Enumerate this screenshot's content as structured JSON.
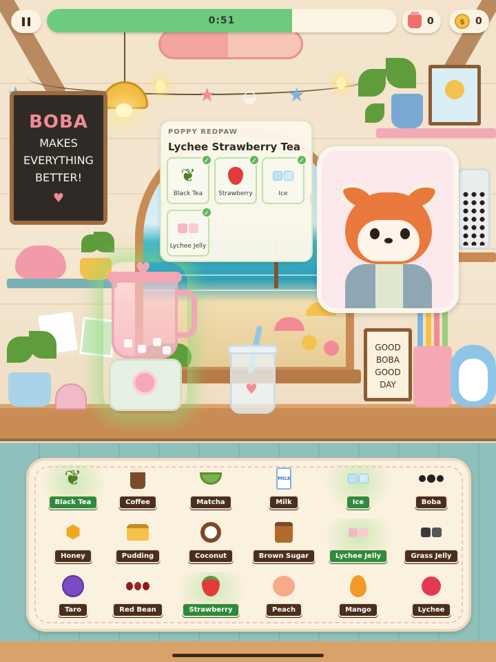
{
  "hud": {
    "timer_text": "0:51",
    "timer_fraction": 0.7,
    "cups_count": "0",
    "coins_count": "0",
    "coin_symbol": "$"
  },
  "decor": {
    "chalkboard": [
      "BOBA",
      "MAKES",
      "EVERYTHING",
      "BETTER!"
    ],
    "sign": [
      "GOOD",
      "BOBA",
      "GOOD DAY"
    ]
  },
  "order": {
    "customer_name": "POPPY REDPAW",
    "drink_name": "Lychee Strawberry Tea",
    "ingredients": [
      {
        "label": "Black Tea",
        "icon": "tea-leaf-icon",
        "done": true
      },
      {
        "label": "Strawberry",
        "icon": "strawberry-icon",
        "done": true
      },
      {
        "label": "Ice",
        "icon": "ice-icon",
        "done": true
      },
      {
        "label": "Lychee Jelly",
        "icon": "lychee-jelly-icon",
        "done": true
      }
    ]
  },
  "ingredients": [
    {
      "label": "Black Tea",
      "icon": "tea-leaf-icon",
      "selected": true
    },
    {
      "label": "Coffee",
      "icon": "coffee-icon",
      "selected": false
    },
    {
      "label": "Matcha",
      "icon": "matcha-icon",
      "selected": false
    },
    {
      "label": "Milk",
      "icon": "milk-icon",
      "selected": false
    },
    {
      "label": "Ice",
      "icon": "ice-icon",
      "selected": true
    },
    {
      "label": "Boba",
      "icon": "boba-icon",
      "selected": false
    },
    {
      "label": "Honey",
      "icon": "honey-icon",
      "selected": false
    },
    {
      "label": "Pudding",
      "icon": "pudding-icon",
      "selected": false
    },
    {
      "label": "Coconut",
      "icon": "coconut-icon",
      "selected": false
    },
    {
      "label": "Brown Sugar",
      "icon": "brown-sugar-icon",
      "selected": false
    },
    {
      "label": "Lychee Jelly",
      "icon": "lychee-jelly-icon",
      "selected": true
    },
    {
      "label": "Grass Jelly",
      "icon": "grass-jelly-icon",
      "selected": false
    },
    {
      "label": "Taro",
      "icon": "taro-icon",
      "selected": false
    },
    {
      "label": "Red Bean",
      "icon": "red-bean-icon",
      "selected": false
    },
    {
      "label": "Strawberry",
      "icon": "strawberry-icon",
      "selected": true
    },
    {
      "label": "Peach",
      "icon": "peach-icon",
      "selected": false
    },
    {
      "label": "Mango",
      "icon": "mango-icon",
      "selected": false
    },
    {
      "label": "Lychee",
      "icon": "lychee-icon",
      "selected": false
    }
  ],
  "colors": {
    "selected_label": "#2f8a3c",
    "default_label": "#4a2e1e",
    "timer_fill": "#6ccb7c"
  }
}
